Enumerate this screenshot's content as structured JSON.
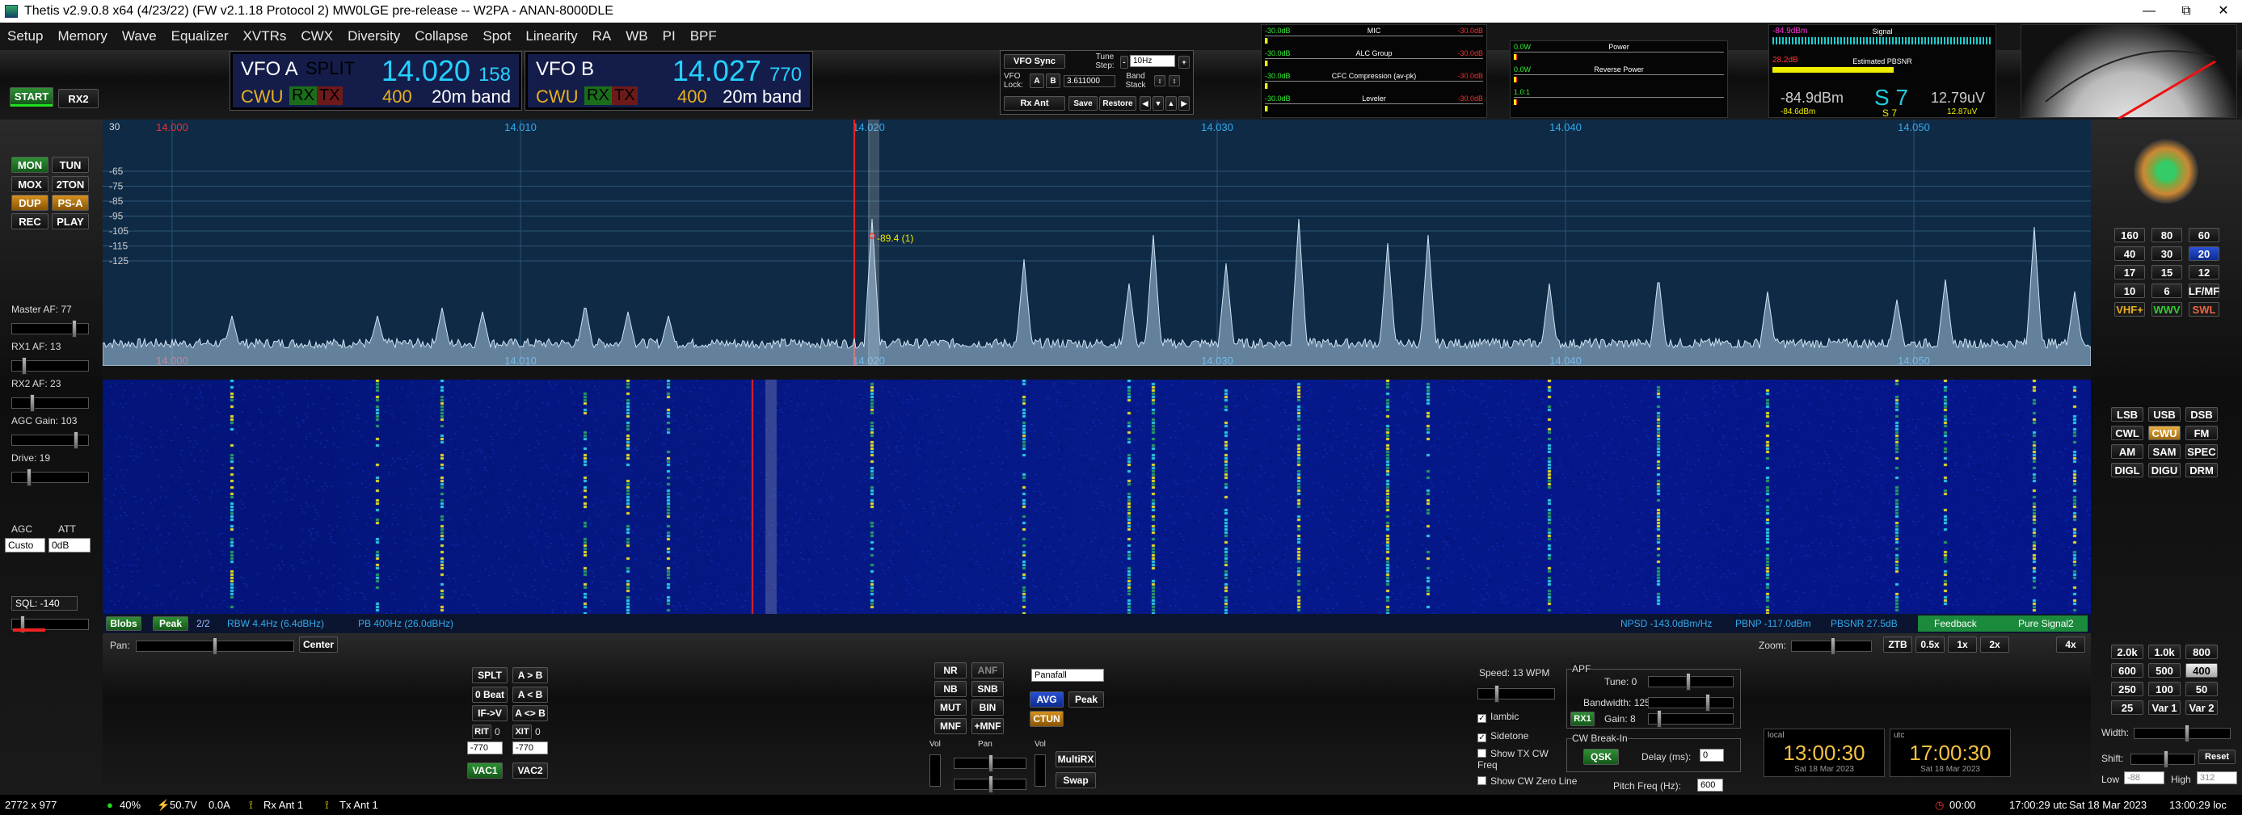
{
  "window": {
    "title": "Thetis v2.9.0.8 x64 (4/23/22) (FW v2.1.18 Protocol 2) MW0LGE pre-release  --  W2PA - ANAN-8000DLE"
  },
  "menu": [
    "Setup",
    "Memory",
    "Wave",
    "Equalizer",
    "XVTRs",
    "CWX",
    "Diversity",
    "Collapse",
    "Spot",
    "Linearity",
    "RA",
    "WB",
    "PI",
    "BPF"
  ],
  "top_left": {
    "start": "START",
    "rx2": "RX2"
  },
  "vfo_a": {
    "name": "VFO A",
    "split": "SPLIT",
    "freq_main": "14.020",
    "freq_sub": "158",
    "mode": "CWU",
    "rx": "RX",
    "tx": "TX",
    "bw": "400",
    "band": "20m band"
  },
  "vfo_b": {
    "name": "VFO B",
    "freq_main": "14.027",
    "freq_sub": "770",
    "mode": "CWU",
    "rx": "RX",
    "tx": "TX",
    "bw": "400",
    "band": "20m band"
  },
  "vfo_ctrl": {
    "sync": "VFO Sync",
    "tune_step_label": "Tune Step:",
    "tune_step_value": "10Hz",
    "lock_label": "VFO Lock:",
    "a": "A",
    "b": "B",
    "lock_value": "3.611000",
    "band_stack": "Band Stack",
    "rx_ant": "Rx Ant",
    "save": "Save",
    "restore": "Restore"
  },
  "tx_meters": [
    {
      "title": "MIC",
      "l": "-30.0dB",
      "r": "-30.0dB"
    },
    {
      "title": "ALC Group",
      "l": "-30.0dB",
      "r": "-30.0dB"
    },
    {
      "title": "CFC Compression (av-pk)",
      "l": "-30.0dB",
      "r": "-30.0dB"
    },
    {
      "title": "Leveler",
      "l": "-30.0dB",
      "r": "-30.0dB"
    }
  ],
  "power_meters": [
    {
      "title": "Power",
      "l": "0.0W"
    },
    {
      "title": "Reverse Power",
      "l": "0.0W"
    },
    {
      "title": "",
      "l": "1.0:1"
    }
  ],
  "rx_meter": {
    "top_l": "-84.9dBm",
    "signal": "Signal",
    "pbsnr_l": "28.2dB",
    "pbsnr": "Estimated PBSNR",
    "dbm": "-84.9dBm",
    "s": "S 7",
    "uv": "12.79uV",
    "dbm2": "-84.6dBm",
    "s2": "S 7",
    "uv2": "12.87uV"
  },
  "left_panel": {
    "mon": "MON",
    "tun": "TUN",
    "mox": "MOX",
    "two_ton": "2TON",
    "dup": "DUP",
    "psa": "PS-A",
    "rec": "REC",
    "play": "PLAY",
    "master_af": "Master AF:  77",
    "rx1_af": "RX1 AF:  13",
    "rx2_af": "RX2 AF:  23",
    "agc_gain": "AGC Gain:  103",
    "drive": "Drive:  19",
    "agc": "AGC",
    "att": "ATT",
    "agc_val": "Custo",
    "att_val": "0dB",
    "sql": "SQL:  -140"
  },
  "spectrum": {
    "top_ref": "30",
    "freq_labels": [
      "14.000",
      "14.010",
      "14.020",
      "14.030",
      "14.040",
      "14.050"
    ],
    "db_labels": [
      "-65",
      "-75",
      "-85",
      "-95",
      "-105",
      "-115",
      "-125"
    ],
    "marker": "-89.4 (1)"
  },
  "info_bar": {
    "blobs": "Blobs",
    "peak": "Peak",
    "count": "2/2",
    "rbw": "RBW 4.4Hz (6.4dBHz)",
    "pb": "PB 400Hz (26.0dBHz)",
    "npsd": "NPSD -143.0dBm/Hz",
    "pbnp": "PBNP -117.0dBm",
    "pbsnr": "PBSNR 27.5dB",
    "feedback": "Feedback",
    "pure": "Pure Signal2"
  },
  "pan": {
    "label": "Pan:",
    "center": "Center",
    "zoom": "Zoom:",
    "ztb": "ZTB",
    "z05": "0.5x",
    "z1": "1x",
    "z2": "2x",
    "z4": "4x"
  },
  "split_ctrl": {
    "splt": "SPLT",
    "ab": "A > B",
    "zero_beat": "0 Beat",
    "ba": "A < B",
    "if_v": "IF->V",
    "swap": "A <> B",
    "rit": "RIT",
    "rit_v": "0",
    "xit": "XIT",
    "xit_v": "0",
    "rit_off": "-770",
    "xit_off": "-770",
    "vac1": "VAC1",
    "vac2": "VAC2"
  },
  "dsp": {
    "nr": "NR",
    "anf": "ANF",
    "nb": "NB",
    "snb": "SNB",
    "mut": "MUT",
    "bin": "BIN",
    "mnf": "MNF",
    "pmnf": "+MNF",
    "display": "Panafall",
    "avg": "AVG",
    "peak": "Peak",
    "ctun": "CTUN",
    "vol": "Vol",
    "pan": "Pan",
    "vol2": "Vol",
    "multirx": "MultiRX",
    "swap": "Swap"
  },
  "cw": {
    "speed": "Speed:  13 WPM",
    "iambic": "Iambic",
    "sidetone": "Sidetone",
    "show_tx": "Show TX CW Freq",
    "show_zero": "Show CW Zero Line",
    "apf": "APF",
    "tune": "Tune:  0",
    "bandwidth": "Bandwidth:  125",
    "rx1": "RX1",
    "gain": "Gain:  8",
    "breakin": "CW Break-In",
    "qsk": "QSK",
    "delay": "Delay (ms):",
    "delay_v": "0",
    "pitch": "Pitch Freq (Hz):",
    "pitch_v": "600"
  },
  "clocks": {
    "local_lbl": "local",
    "local": "13:00:30",
    "local_date": "Sat 18 Mar 2023",
    "utc_lbl": "utc",
    "utc": "17:00:30",
    "utc_date": "Sat 18 Mar 2023"
  },
  "bands": [
    "160",
    "80",
    "60",
    "40",
    "30",
    "20",
    "17",
    "15",
    "12",
    "10",
    "6",
    "LF/MF",
    "VHF+",
    "WWV",
    "SWL"
  ],
  "modes": [
    "LSB",
    "USB",
    "DSB",
    "CWL",
    "CWU",
    "FM",
    "AM",
    "SAM",
    "SPEC",
    "DIGL",
    "DIGU",
    "DRM"
  ],
  "filters": [
    "2.0k",
    "1.0k",
    "800",
    "600",
    "500",
    "400",
    "250",
    "100",
    "50",
    "25",
    "Var 1",
    "Var 2"
  ],
  "filter_ctrl": {
    "width": "Width:",
    "shift": "Shift:",
    "reset": "Reset",
    "low": "Low",
    "low_v": "-88",
    "high": "High",
    "high_v": "312"
  },
  "status": {
    "dims": "2772 x 977",
    "cpu": "40%",
    "volt": "50.7V",
    "amp": "0.0A",
    "rx_ant": "Rx Ant 1",
    "tx_ant": "Tx Ant 1",
    "timer": "00:00",
    "utc": "17:00:29 utc",
    "date": "Sat 18 Mar 2023",
    "local": "13:00:29 loc"
  }
}
